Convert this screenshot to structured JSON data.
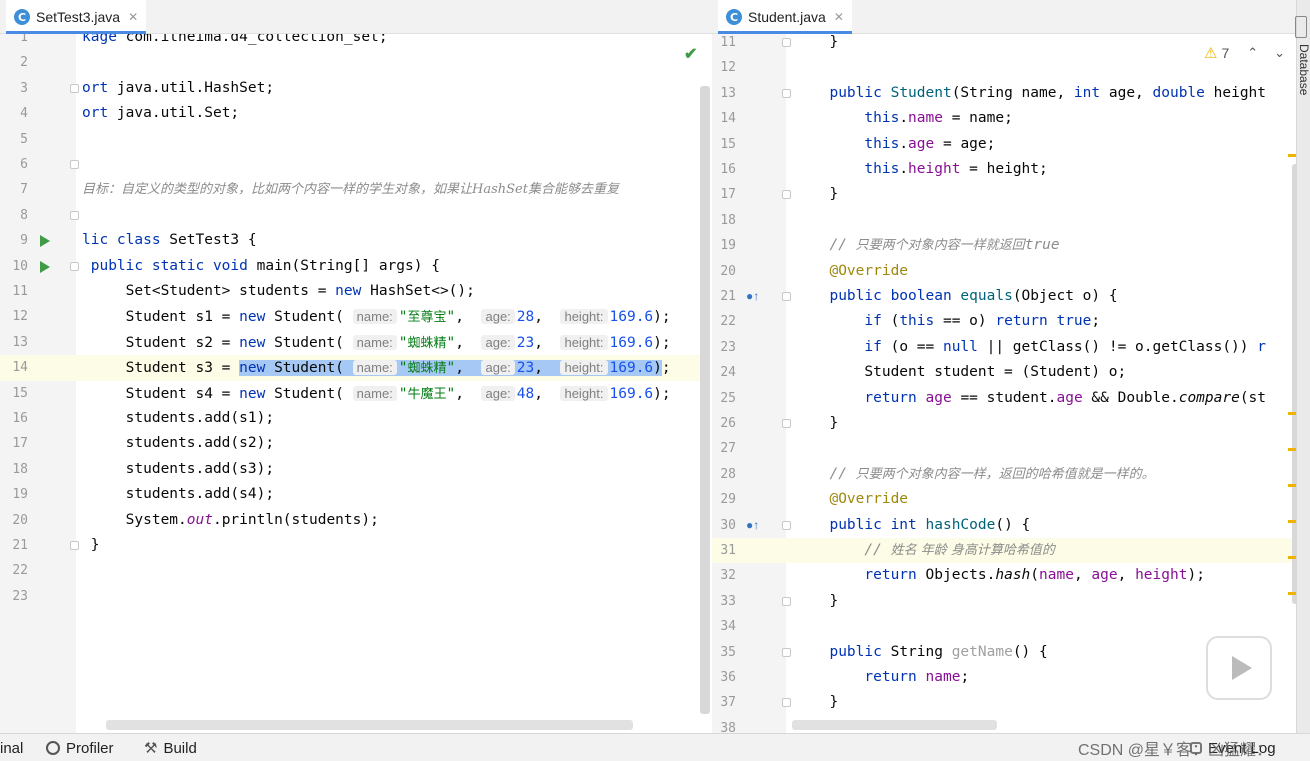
{
  "left_editor": {
    "tab": {
      "icon": "C",
      "label": "SetTest3.java",
      "close": "✕"
    },
    "lines": [
      {
        "n": "1",
        "html": "<span class=\"kw\">kage</span> com.itheima.d4_collection_set;"
      },
      {
        "n": "2",
        "html": ""
      },
      {
        "n": "3",
        "html": "<span class=\"kw\">ort</span> java.util.HashSet;"
      },
      {
        "n": "4",
        "html": "<span class=\"kw\">ort</span> java.util.Set;"
      },
      {
        "n": "5",
        "html": ""
      },
      {
        "n": "6",
        "html": ""
      },
      {
        "n": "7",
        "html": "<span class=\"cm cn\">目标：自定义的类型的对象，比如两个内容一样的学生对象，如果让HashSet集合能够去重复</span>"
      },
      {
        "n": "8",
        "html": ""
      },
      {
        "n": "9",
        "html": "<span class=\"kw\">lic class</span> SetTest3 {"
      },
      {
        "n": "10",
        "html": " <span class=\"kw\">public static void</span> main(String[] args) {"
      },
      {
        "n": "11",
        "html": "     Set&lt;Student&gt; students = <span class=\"kw\">new</span> HashSet&lt;&gt;();"
      },
      {
        "n": "12",
        "html": "     Student s1 = <span class=\"kw\">new</span> Student( <span class=\"hint\">name:</span><span class=\"str\">\"<span class=\"cn\">至尊宝</span>\"</span>,  <span class=\"hint\">age:</span><span class=\"num\">28</span>,  <span class=\"hint\">height:</span><span class=\"num\">169.6</span>);"
      },
      {
        "n": "13",
        "html": "     Student s2 = <span class=\"kw\">new</span> Student( <span class=\"hint\">name:</span><span class=\"str\">\"<span class=\"cn\">蜘蛛精</span>\"</span>,  <span class=\"hint\">age:</span><span class=\"num\">23</span>,  <span class=\"hint\">height:</span><span class=\"num\">169.6</span>);"
      },
      {
        "n": "14",
        "html": "     Student s3 = <span class=\"sel\"><span class=\"kw\">new</span> Student( <span class=\"hint\">name:</span><span class=\"str\">\"<span class=\"cn\">蜘蛛精</span>\"</span>,  <span class=\"hint\">age:</span><span class=\"num\">23</span>,  <span class=\"hint\">height:</span><span class=\"num\">169.6</span>)</span>;"
      },
      {
        "n": "15",
        "html": "     Student s4 = <span class=\"kw\">new</span> Student( <span class=\"hint\">name:</span><span class=\"str\">\"<span class=\"cn\">牛魔王</span>\"</span>,  <span class=\"hint\">age:</span><span class=\"num\">48</span>,  <span class=\"hint\">height:</span><span class=\"num\">169.6</span>);"
      },
      {
        "n": "16",
        "html": "     students.add(s1);"
      },
      {
        "n": "17",
        "html": "     students.add(s2);"
      },
      {
        "n": "18",
        "html": "     students.add(s3);"
      },
      {
        "n": "19",
        "html": "     students.add(s4);"
      },
      {
        "n": "20",
        "html": "     System.<span class=\"fld it\">out</span>.println(students);"
      },
      {
        "n": "21",
        "html": " }"
      },
      {
        "n": "22",
        "html": ""
      },
      {
        "n": "23",
        "html": ""
      }
    ]
  },
  "right_editor": {
    "tab": {
      "icon": "C",
      "label": "Student.java",
      "close": "✕"
    },
    "warning_count": "7",
    "lines": [
      {
        "n": "11",
        "html": "  }"
      },
      {
        "n": "12",
        "html": ""
      },
      {
        "n": "13",
        "html": "  <span class=\"kw\">public</span> <span class=\"mth\">Student</span>(String name, <span class=\"kw\">int</span> age, <span class=\"kw\">double</span> height"
      },
      {
        "n": "14",
        "html": "      <span class=\"kw\">this</span>.<span class=\"fld\">name</span> = name;"
      },
      {
        "n": "15",
        "html": "      <span class=\"kw\">this</span>.<span class=\"fld\">age</span> = age;"
      },
      {
        "n": "16",
        "html": "      <span class=\"kw\">this</span>.<span class=\"fld\">height</span> = height;"
      },
      {
        "n": "17",
        "html": "  }"
      },
      {
        "n": "18",
        "html": ""
      },
      {
        "n": "19",
        "html": "  <span class=\"cm\">// <span class=\"cn\">只要两个对象内容一样就返回</span>true</span>"
      },
      {
        "n": "20",
        "html": "  <span class=\"ann\">@Override</span>"
      },
      {
        "n": "21",
        "html": "  <span class=\"kw\">public boolean</span> <span class=\"mth\">equals</span>(Object o) {"
      },
      {
        "n": "22",
        "html": "      <span class=\"kw\">if</span> (<span class=\"kw\">this</span> == o) <span class=\"kw\">return true</span>;"
      },
      {
        "n": "23",
        "html": "      <span class=\"kw\">if</span> (o == <span class=\"kw\">null</span> || getClass() != o.getClass()) <span class=\"kw\">r</span>"
      },
      {
        "n": "24",
        "html": "      Student student = (Student) o;"
      },
      {
        "n": "25",
        "html": "      <span class=\"kw\">return</span> <span class=\"fld\">age</span> == student.<span class=\"fld\">age</span> &amp;&amp; Double.<span class=\"it\">compare</span>(st"
      },
      {
        "n": "26",
        "html": "  }"
      },
      {
        "n": "27",
        "html": ""
      },
      {
        "n": "28",
        "html": "  <span class=\"cm\">// <span class=\"cn\">只要两个对象内容一样，返回的哈希值就是一样的。</span></span>"
      },
      {
        "n": "29",
        "html": "  <span class=\"ann\">@Override</span>"
      },
      {
        "n": "30",
        "html": "  <span class=\"kw\">public int</span> <span class=\"mth\">hashCode</span>() {"
      },
      {
        "n": "31",
        "html": "      <span class=\"cm\">// <span class=\"cn\">姓名 年龄 身高计算哈希值的</span></span>"
      },
      {
        "n": "32",
        "html": "      <span class=\"kw\">return</span> Objects.<span class=\"it\">hash</span>(<span class=\"fld\">name</span>, <span class=\"fld\">age</span>, <span class=\"fld\">height</span>);"
      },
      {
        "n": "33",
        "html": "  }"
      },
      {
        "n": "34",
        "html": ""
      },
      {
        "n": "35",
        "html": "  <span class=\"kw\">public</span> String <span class=\"gray\">getName</span>() {"
      },
      {
        "n": "36",
        "html": "      <span class=\"kw\">return</span> <span class=\"fld\">name</span>;"
      },
      {
        "n": "37",
        "html": "  }"
      },
      {
        "n": "38",
        "html": ""
      }
    ]
  },
  "bottom_bar": {
    "terminal": "inal",
    "profiler": "Profiler",
    "build": "Build",
    "event_log": "Event Log",
    "watermark": "CSDN @星￥客：凶猛耀："
  },
  "side_panel": {
    "database": "Database"
  },
  "colors": {
    "keyword": "#0033b3",
    "string": "#067d17",
    "number": "#1750eb",
    "field": "#871094",
    "comment": "#8c8c8c",
    "annotation": "#9e880d",
    "selection": "#a6c8f5",
    "warning": "#f0b400",
    "run": "#3f9b47",
    "tab_underline": "#4a8ae2"
  }
}
